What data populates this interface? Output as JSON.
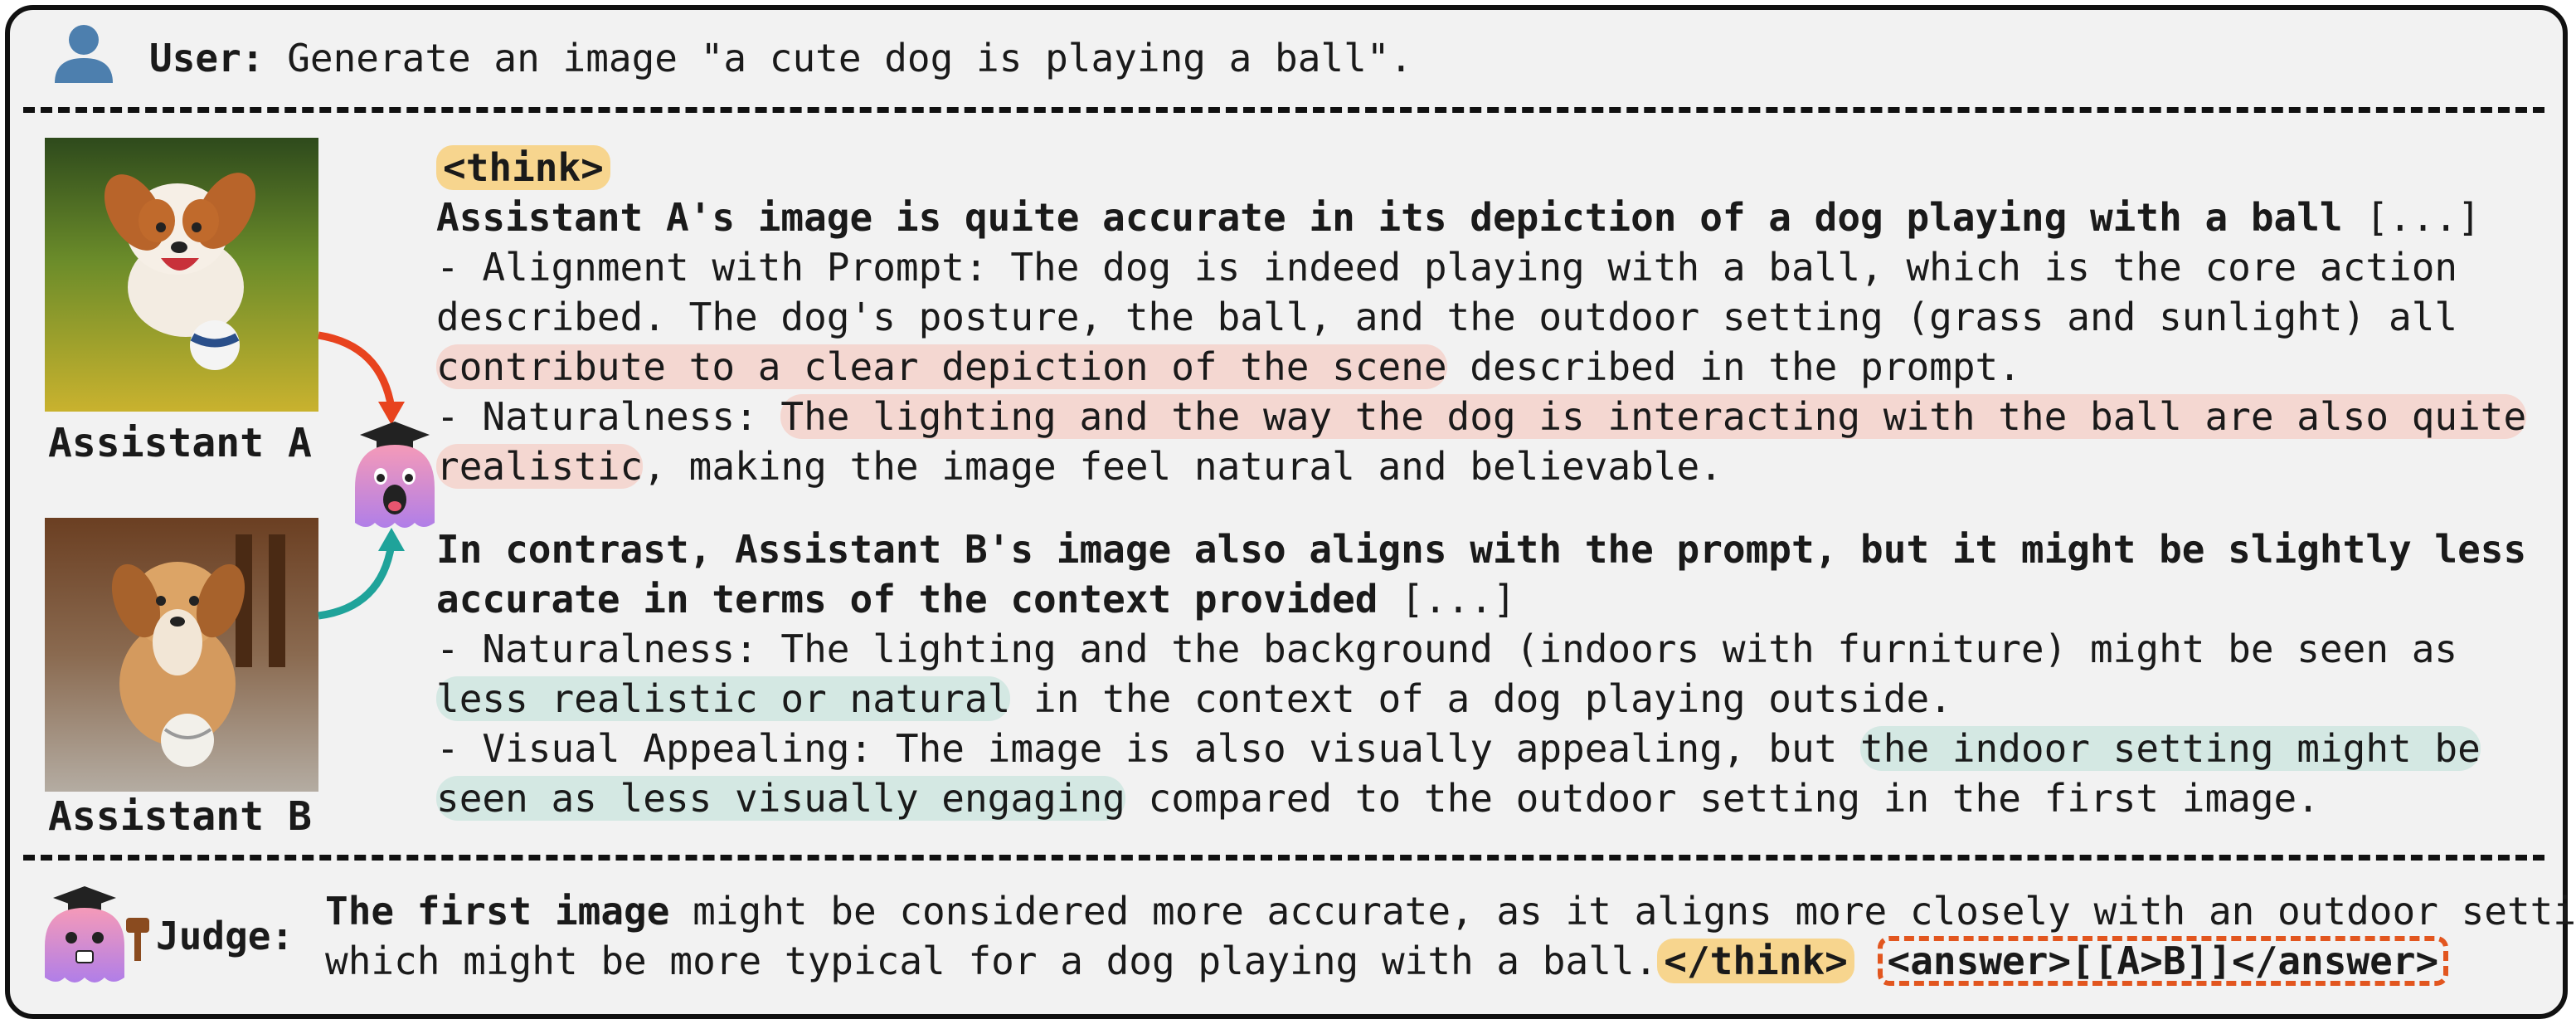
{
  "user": {
    "label": "User:",
    "prompt": "Generate an image \"a cute dog is playing a ball\"."
  },
  "assistants": {
    "a_label": "Assistant A",
    "b_label": "Assistant B"
  },
  "reasoning": {
    "think_open": "<think>",
    "a_heading": "Assistant A's image is quite accurate in its depiction of a dog playing with a ball",
    "ellipsis": "[...]",
    "a_align_1": "- Alignment with Prompt: The dog is indeed playing with a ball, which is the core action",
    "a_align_2": "described. The dog's posture, the ball, and the outdoor setting (grass and sunlight) all",
    "a_align_3_hl": "contribute to a clear depiction of the scene",
    "a_align_3_rest": " described in the prompt.",
    "a_nat_prefix": "- Naturalness: ",
    "a_nat_hl1": "The lighting and the way the dog is interacting with the ball are also quite",
    "a_nat_hl2": "realistic",
    "a_nat_rest": ", making the image feel natural and believable.",
    "b_heading_1": "In contrast, Assistant B's image also aligns with the prompt, but it might be slightly less",
    "b_heading_2": "accurate in terms of the context provided",
    "b_nat_1": "- Naturalness: The lighting and the background (indoors with furniture) might be seen as",
    "b_nat_2_hl": "less realistic or natural",
    "b_nat_2_rest": " in the context of a dog playing outside.",
    "b_vis_prefix": "- Visual Appealing: The image is also visually appealing, but ",
    "b_vis_hl1": "the indoor setting might be",
    "b_vis_hl2": "seen as less visually engaging",
    "b_vis_rest": " compared to the outdoor setting in the first image."
  },
  "judge": {
    "label": "Judge:",
    "line1_bold": "The first image",
    "line1_rest": " might be considered more accurate, as it aligns more closely with an outdoor setting,",
    "line2": "which might be more typical for a dog playing with a ball.",
    "think_close": "</think>",
    "answer": "<answer>[[A>B]]</answer>"
  },
  "colors": {
    "highlight_red": "#f4d7d1",
    "highlight_teal": "#d4e8e3",
    "think_tag": "#f7d58e",
    "arrow_a": "#e8431e",
    "arrow_b": "#1fa39a",
    "answer_border": "#e2561f"
  },
  "icons": [
    "user-icon",
    "mascot-icon",
    "judge-mascot-icon",
    "arrow-a-icon",
    "arrow-b-icon"
  ]
}
